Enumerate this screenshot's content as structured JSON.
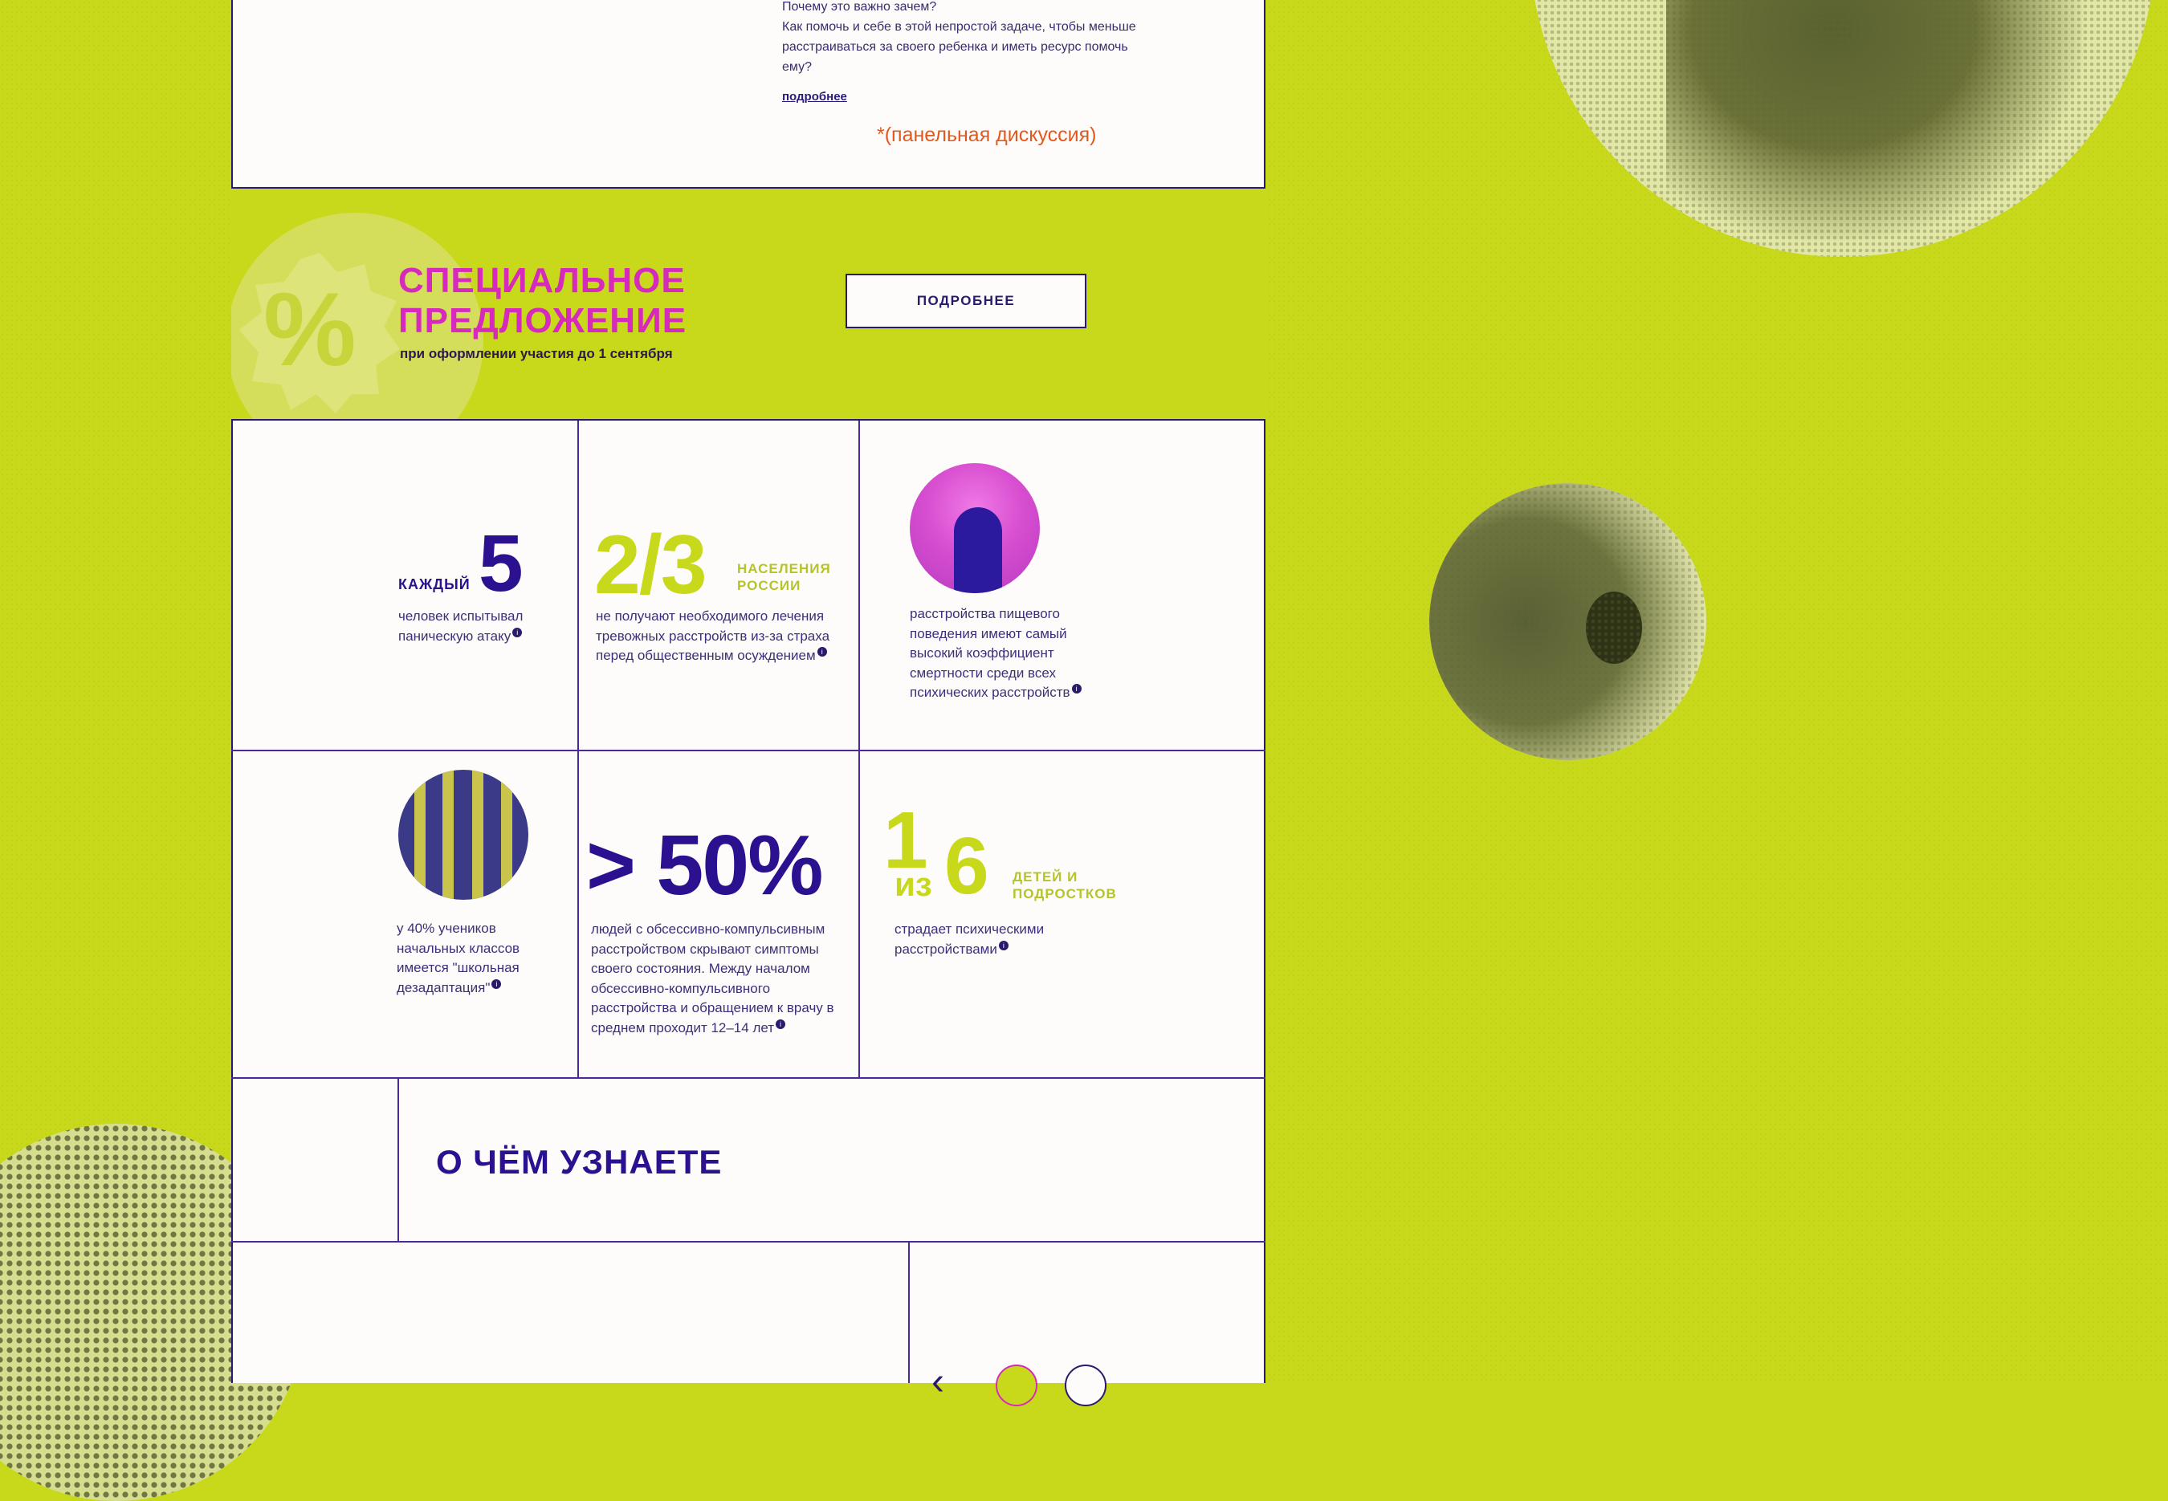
{
  "top_section": {
    "text": "Почему это важно зачем?\nКак помочь и себе в этой непростой задаче, чтобы меньше расстраиваться за своего ребенка и иметь ресурс помочь ему?",
    "link": "подробнее",
    "panel_note": "*(панельная дискуссия)"
  },
  "offer": {
    "title": "СПЕЦИАЛЬНОЕ\nПРЕДЛОЖЕНИЕ",
    "subtitle": "при оформлении участия до 1 сентября",
    "button": "ПОДРОБНЕЕ",
    "badge_symbol": "%"
  },
  "stats": [
    {
      "prefix": "КАЖДЫЙ",
      "number": "5",
      "desc": "человек испытывал паническую атаку"
    },
    {
      "number": "2/3",
      "label_1": "НАСЕЛЕНИЯ",
      "label_2": "РОССИИ",
      "desc": "не получают необходимого лечения тревожных расстройств из-за страха перед общественным осуждением"
    },
    {
      "desc": "расстройства пищевого поведения имеют самый высокий коэффициент смертности среди всех психических расстройств"
    },
    {
      "desc": "у 40% учеников начальных классов имеется \"школьная дезадаптация\""
    },
    {
      "number": "> 50%",
      "desc": "людей с обсессивно-компульсивным расстройством скрывают симптомы своего состояния. Между началом обсессивно-компульсивного расстройства и обращением к врачу в среднем проходит 12–14 лет"
    },
    {
      "num_a": "1",
      "mid": "из",
      "num_b": "6",
      "label_1": "ДЕТЕЙ И",
      "label_2": "ПОДРОСТКОВ",
      "desc": "страдает психическими расстройствами"
    }
  ],
  "info_glyph": "i",
  "learn": {
    "title": "О ЧЁМ УЗНАЕТЕ"
  },
  "nav": {
    "prev_glyph": "‹"
  },
  "colors": {
    "background": "#c8d81a",
    "panel": "#fdfcfa",
    "ink": "#2a1a6e",
    "magenta": "#d52abb",
    "lime": "#c8d81a",
    "orange": "#e05a1f",
    "violet": "#2b1190"
  }
}
